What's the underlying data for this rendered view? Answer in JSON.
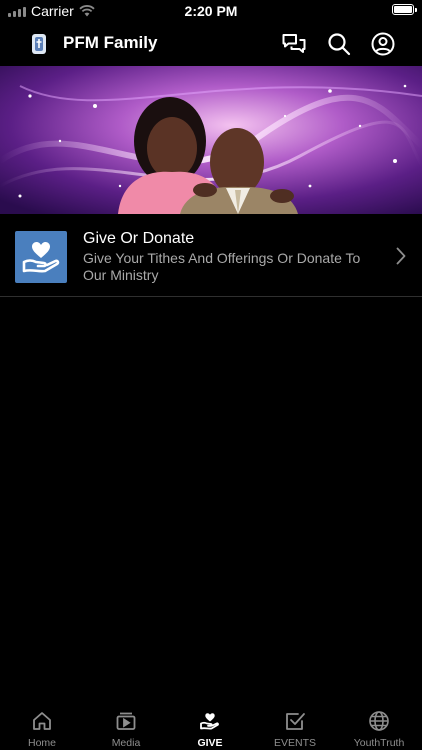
{
  "status_bar": {
    "carrier": "Carrier",
    "time": "2:20 PM"
  },
  "nav": {
    "title": "PFM Family",
    "icons": [
      "chat-bubbles-icon",
      "search-icon",
      "profile-icon"
    ]
  },
  "list": {
    "items": [
      {
        "title": "Give Or Donate",
        "subtitle": "Give Your Tithes And Offerings Or Donate To Our Ministry",
        "icon": "hand-heart-icon"
      }
    ]
  },
  "tabs": [
    {
      "label": "Home",
      "icon": "home-icon",
      "active": false
    },
    {
      "label": "Media",
      "icon": "media-play-icon",
      "active": false
    },
    {
      "label": "GIVE",
      "icon": "hand-heart-icon",
      "active": true
    },
    {
      "label": "EVENTS",
      "icon": "checkbox-icon",
      "active": false
    },
    {
      "label": "YouthTruth",
      "icon": "globe-icon",
      "active": false
    }
  ],
  "colors": {
    "background": "#000000",
    "thumb_blue": "#4a7fbe",
    "banner_purple": "#7a2f9e",
    "inactive_tab": "#8e8e8e"
  }
}
